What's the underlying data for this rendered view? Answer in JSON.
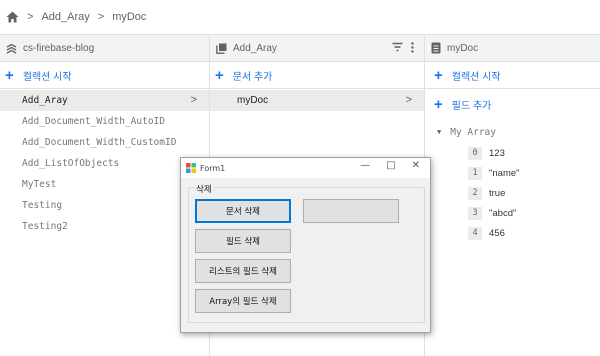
{
  "breadcrumb": {
    "items": [
      "Add_Aray",
      "myDoc"
    ],
    "separator": ">"
  },
  "col1": {
    "header": "cs-firebase-blog",
    "add_label": "컬렉션 시작",
    "items": [
      "Add_Aray",
      "Add_Document_Width_AutoID",
      "Add_Document_Width_CustomID",
      "Add_ListOfObjects",
      "MyTest",
      "Testing",
      "Testing2"
    ],
    "selected": "Add_Aray"
  },
  "col2": {
    "header": "Add_Aray",
    "add_label": "문서 추가",
    "items": [
      "myDoc"
    ]
  },
  "col3": {
    "header": "myDoc",
    "add_collection_label": "컬렉션 시작",
    "add_field_label": "필드 추가",
    "field_name": "My Array",
    "array": [
      {
        "index": "0",
        "value": "123"
      },
      {
        "index": "1",
        "value": "\"name\""
      },
      {
        "index": "2",
        "value": "true"
      },
      {
        "index": "3",
        "value": "\"abcd\""
      },
      {
        "index": "4",
        "value": "456"
      }
    ]
  },
  "form": {
    "title": "Form1",
    "group_label": "삭제",
    "buttons": {
      "delete_document": "문서 삭제",
      "delete_field": "필드 삭제",
      "delete_list_field": "리스트의 필드 삭제",
      "delete_array_field": "Array의 필드 삭제",
      "blank": ""
    }
  },
  "colors": {
    "accent": "#1a73e8",
    "header_bg": "#f1f3f4",
    "selected_bg": "#ebebeb",
    "focus_border": "#0078d7"
  }
}
